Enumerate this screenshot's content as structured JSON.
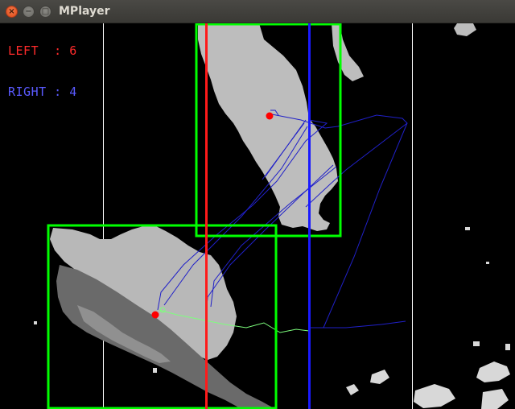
{
  "window": {
    "title": "MPlayer",
    "close_glyph": "×",
    "minimize_glyph": "−",
    "maximize_glyph": "□"
  },
  "overlay": {
    "left_counter": "LEFT  : 6",
    "right_counter": "RIGHT : 4"
  },
  "colors": {
    "left_line": "#ff1a1a",
    "right_line": "#1a1aff",
    "box": "#00ff00",
    "track": "#2020c8",
    "trail": "#7dff7d",
    "blob": "#bfbfbf",
    "centroid": "#ff0000"
  },
  "icons": {
    "close": "close-icon",
    "minimize": "minimize-icon",
    "maximize": "maximize-icon"
  }
}
